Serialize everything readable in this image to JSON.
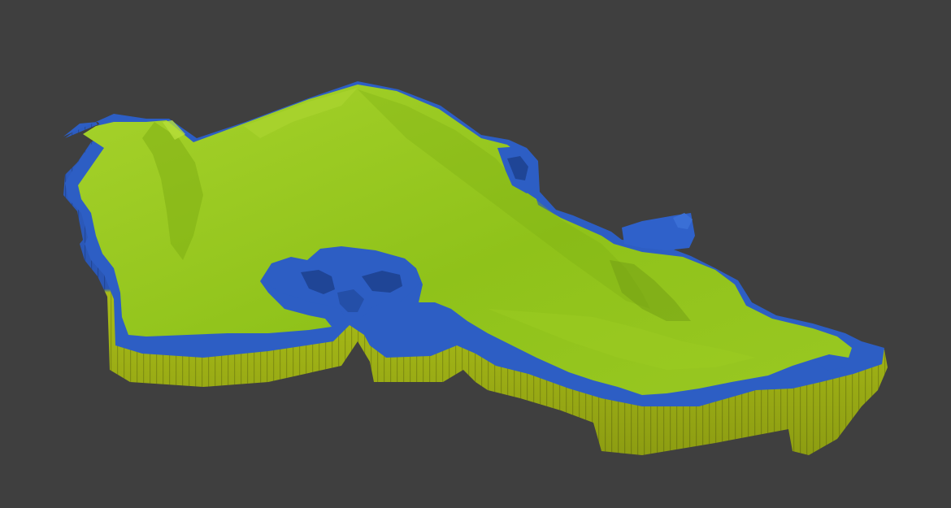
{
  "viewport": {
    "background": "#3f3f3f"
  },
  "model": {
    "kind": "terrain-relief-model",
    "colors": {
      "land_top": "#8fc21a",
      "land_top_light": "#a5d42a",
      "land_shadow": "#6f9a14",
      "water_blue": "#2d5ec4",
      "water_blue_light": "#3a6fd6",
      "water_blue_dark": "#1f4596",
      "base_yellow": "#b0c41a",
      "base_yellow_dark": "#8a9a12"
    }
  }
}
